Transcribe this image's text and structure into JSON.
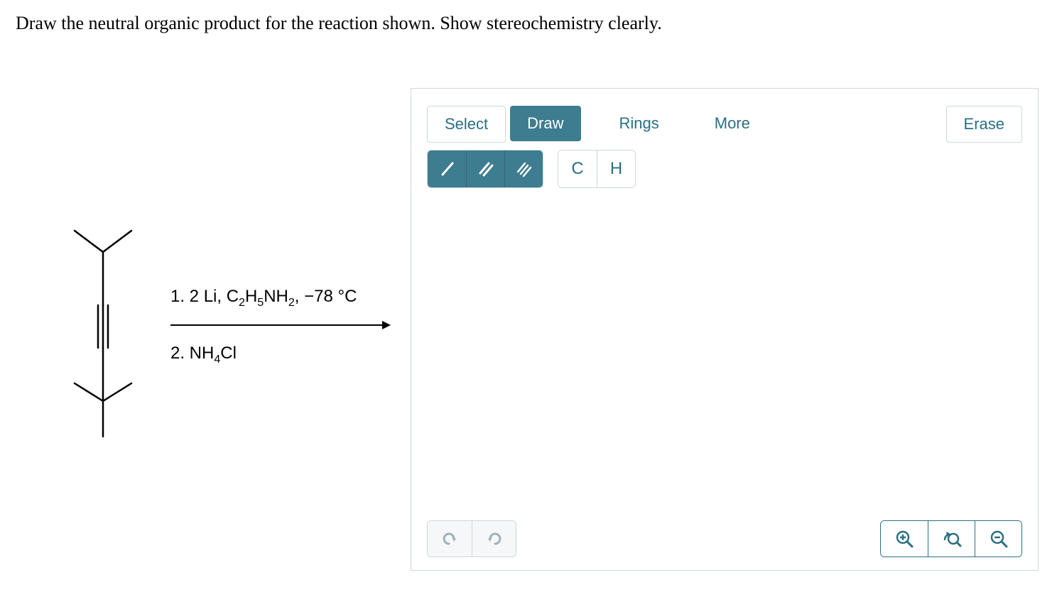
{
  "prompt": "Draw the neutral organic product for the reaction shown. Show stereochemistry clearly.",
  "reagents": {
    "line1_prefix": "1. 2 Li, C",
    "line1_sub1": "2",
    "line1_mid1": "H",
    "line1_sub2": "5",
    "line1_mid2": "NH",
    "line1_sub3": "2",
    "line1_suffix": ", −78 °C",
    "line2_prefix": "2. NH",
    "line2_sub1": "4",
    "line2_suffix": "Cl"
  },
  "toolbar": {
    "select": "Select",
    "draw": "Draw",
    "rings": "Rings",
    "more": "More",
    "erase": "Erase"
  },
  "bonds": {
    "single": "/",
    "double": "//",
    "triple": "///"
  },
  "atoms": {
    "c": "C",
    "h": "H"
  },
  "icons": {
    "undo": "↺",
    "redo": "↻",
    "zoom_in": "⊕",
    "zoom_reset": "↶",
    "zoom_out": "⊖"
  }
}
